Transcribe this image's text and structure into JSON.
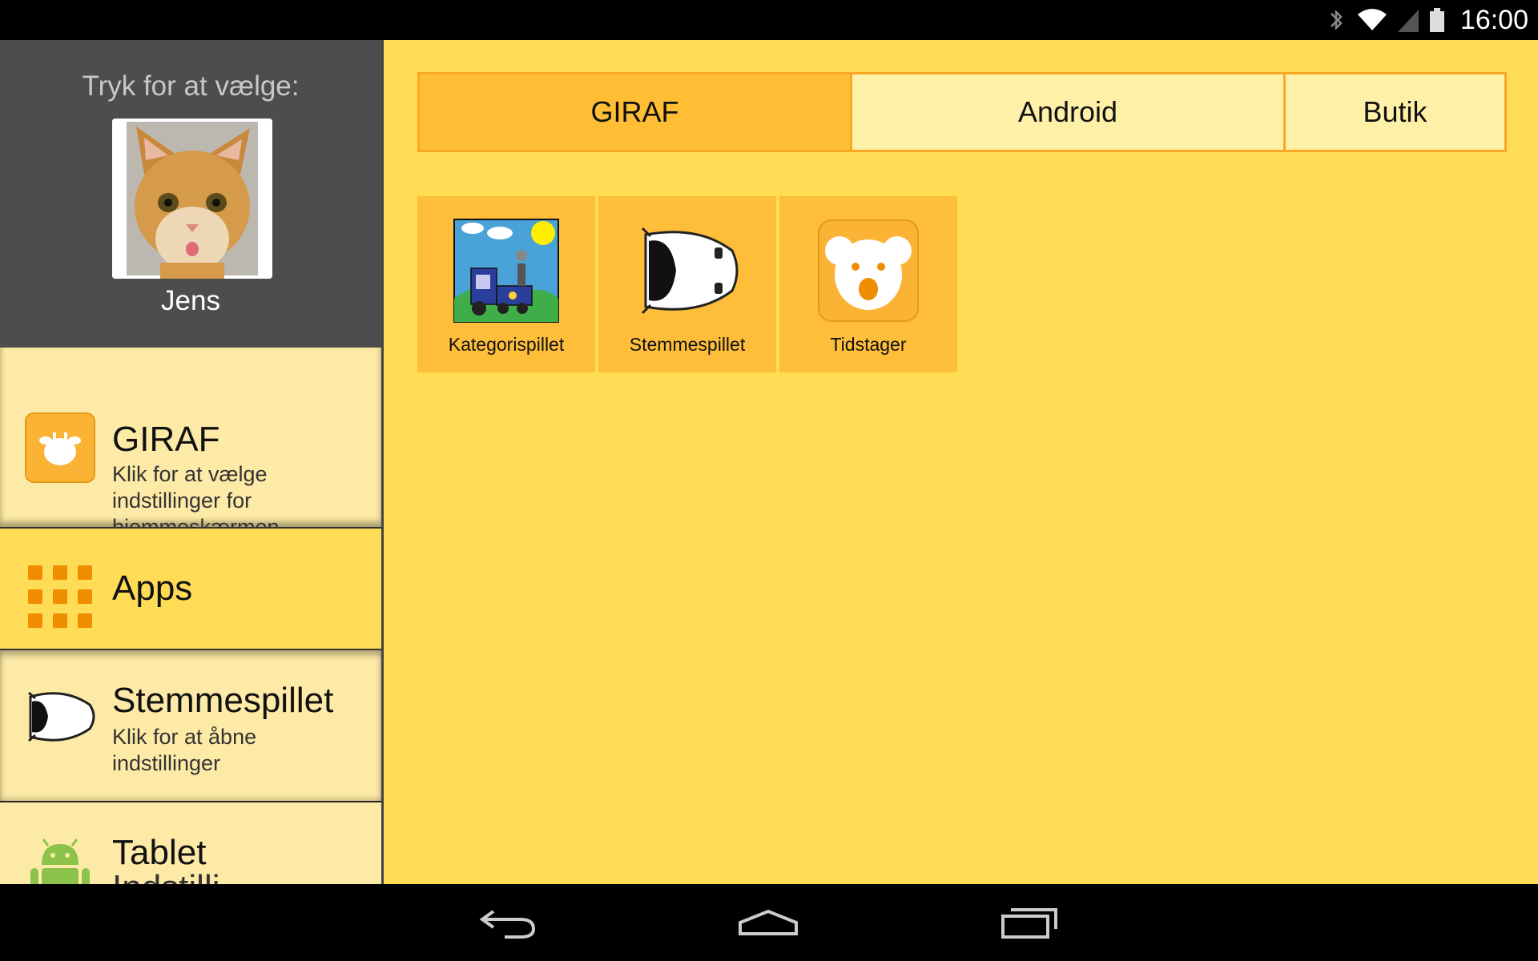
{
  "status_bar": {
    "time": "16:00",
    "icons": [
      "bluetooth-icon",
      "wifi-icon",
      "signal-icon",
      "battery-icon"
    ]
  },
  "sidebar": {
    "profile": {
      "prompt": "Tryk for at vælge:",
      "name": "Jens"
    },
    "items": [
      {
        "title": "GIRAF",
        "subtitle": "Klik for at vælge indstillinger for hjemmeskærmen",
        "icon": "giraf-icon"
      },
      {
        "title": "Apps",
        "icon": "apps-grid-icon"
      },
      {
        "title": "Stemmespillet",
        "subtitle": "Klik for at åbne indstillinger",
        "icon": "stemmespillet-icon"
      },
      {
        "title": "Tablet",
        "subtitle": "Indstilli",
        "icon": "android-icon"
      }
    ]
  },
  "main": {
    "tabs": [
      {
        "label": "GIRAF",
        "active": true
      },
      {
        "label": "Android",
        "active": false
      },
      {
        "label": "Butik",
        "active": false
      }
    ],
    "apps": [
      {
        "label": "Kategorispillet",
        "icon": "train-picture-icon"
      },
      {
        "label": "Stemmespillet",
        "icon": "car-icon"
      },
      {
        "label": "Tidstager",
        "icon": "koala-icon"
      }
    ]
  },
  "nav_bar": {
    "buttons": [
      "back-icon",
      "home-icon",
      "recents-icon"
    ]
  },
  "colors": {
    "main_bg": "#ffde55",
    "tab_active": "#ffbe33",
    "tab_inactive": "#fff0a8",
    "tab_border": "#f9a825",
    "sidebar_dark": "#4d4d4d",
    "sidebar_item": "#fdeaa6"
  }
}
